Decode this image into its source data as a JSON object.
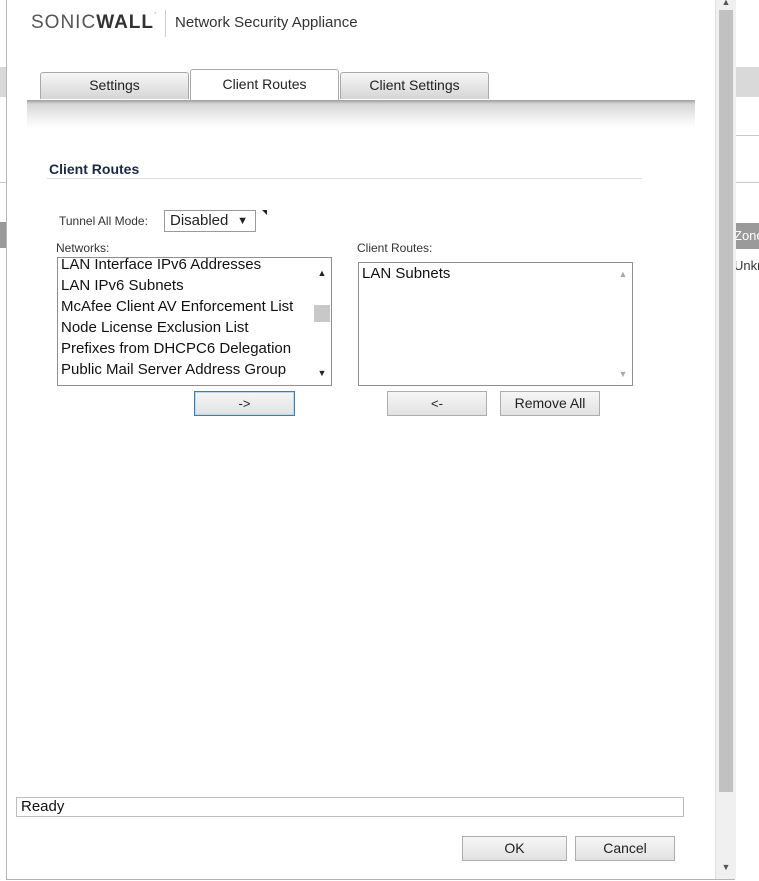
{
  "background_window": {
    "right_cells": [
      "Zone",
      "Unkn"
    ]
  },
  "header": {
    "brand_light": "SONIC",
    "brand_bold": "WALL",
    "brand_tm": "˙",
    "product": "Network Security Appliance"
  },
  "tabs": [
    {
      "label": "Settings",
      "active": false
    },
    {
      "label": "Client Routes",
      "active": true
    },
    {
      "label": "Client Settings",
      "active": false
    }
  ],
  "section": {
    "title": "Client Routes"
  },
  "tunnel_all_mode": {
    "label": "Tunnel All Mode:",
    "value": "Disabled",
    "caret": "▼"
  },
  "networks": {
    "label": "Networks:",
    "items": [
      "LAN Interface IPv6 Addresses",
      "LAN IPv6 Subnets",
      "McAfee Client AV Enforcement List",
      "Node License Exclusion List",
      "Prefixes from DHCPC6 Delegation",
      "Public Mail Server Address Group"
    ]
  },
  "client_routes": {
    "label": "Client Routes:",
    "items": [
      "LAN Subnets"
    ]
  },
  "buttons": {
    "add": "->",
    "remove": "<-",
    "remove_all": "Remove All",
    "ok": "OK",
    "cancel": "Cancel"
  },
  "status": {
    "text": "Ready"
  },
  "icons": {
    "scroll_up": "▲",
    "scroll_down": "▼"
  }
}
